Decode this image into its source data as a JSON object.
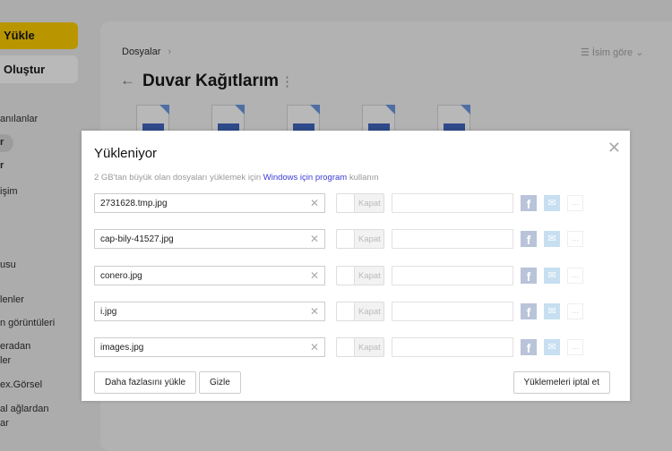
{
  "sidebar": {
    "upload_label": "Yükle",
    "create_label": "Oluştur",
    "items": [
      "anılanlar",
      "r",
      "r",
      "işim",
      "usu",
      "lenler",
      "n görüntüleri",
      "eradan",
      "ler",
      "ex.Görsel",
      "al ağlardan",
      "ar"
    ]
  },
  "header": {
    "breadcrumb": "Dosyalar",
    "breadcrumb_sep": "›",
    "sort_label": "İsim göre",
    "title": "Duvar Kağıtlarım"
  },
  "dialog": {
    "title": "Yükleniyor",
    "hint_before": "2 GB'tan büyük olan dosyaları yüklemek için ",
    "hint_link": "Windows için program",
    "hint_after": " kullanın",
    "toggle_label": "Kapat",
    "files": [
      "2731628.tmp.jpg",
      "cap-bily-41527.jpg",
      "conero.jpg",
      "i.jpg",
      "images.jpg"
    ],
    "more_button": "Daha fazlasını yükle",
    "hide_button": "Gizle",
    "cancel_button": "Yüklemeleri iptal et"
  },
  "colors": {
    "accent": "#ffcc00",
    "link": "#3b3bd8"
  }
}
